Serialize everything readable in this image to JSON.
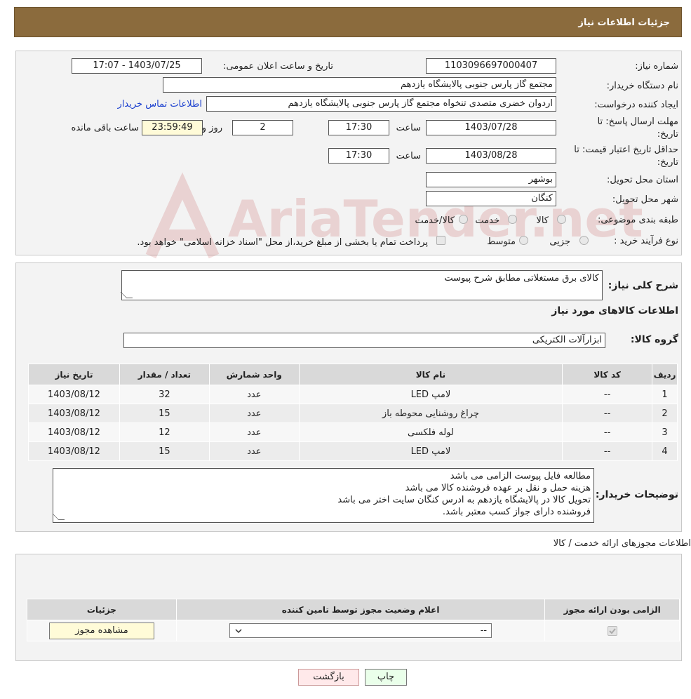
{
  "header": {
    "title": "جزئیات اطلاعات نیاز"
  },
  "info": {
    "need_number_label": "شماره نیاز:",
    "need_number": "1103096697000407",
    "announce_label": "تاریخ و ساعت اعلان عمومی:",
    "announce_value": "1403/07/25 - 17:07",
    "buyer_org_label": "نام دستگاه خریدار:",
    "buyer_org": "مجتمع گاز پارس جنوبی  پالایشگاه یازدهم",
    "requester_label": "ایجاد کننده درخواست:",
    "requester": "اردوان خضری متصدی تنخواه مجتمع گاز پارس جنوبی  پالایشگاه یازدهم",
    "contact_link": "اطلاعات تماس خریدار",
    "deadline_label_1": "مهلت ارسال پاسخ: تا",
    "deadline_label_2": "تاریخ:",
    "deadline_date": "1403/07/28",
    "time_label": "ساعت",
    "deadline_time": "17:30",
    "days": "2",
    "days_label": "روز و",
    "remaining": "23:59:49",
    "remaining_label": "ساعت باقی مانده",
    "validity_label_1": "حداقل تاریخ اعتبار قیمت: تا",
    "validity_label_2": "تاریخ:",
    "validity_date": "1403/08/28",
    "validity_time_label": "ساعت",
    "validity_time": "17:30",
    "province_label": "استان محل تحویل:",
    "province": "بوشهر",
    "city_label": "شهر محل تحویل:",
    "city": "کنگان",
    "category_label": "طبقه بندی موضوعی:",
    "cat_goods": "کالا",
    "cat_service": "خدمت",
    "cat_both": "کالا/خدمت",
    "process_label": "نوع فرآیند خرید :",
    "proc_partial": "جزیی",
    "proc_medium": "متوسط",
    "proc_note": "پرداخت تمام یا بخشی از مبلغ خرید،از محل \"اسناد خزانه اسلامی\" خواهد بود."
  },
  "desc": {
    "label": "شرح کلی نیاز:",
    "value": "کالای برق مستغلاتی مطابق شرح پیوست"
  },
  "goods_title": "اطلاعات کالاهای مورد نیاز",
  "group": {
    "label": "گروه کالا:",
    "value": "ابزارآلات الکتریکی"
  },
  "table": {
    "headers": [
      "ردیف",
      "کد کالا",
      "نام کالا",
      "واحد شمارش",
      "تعداد / مقدار",
      "تاریخ نیاز"
    ],
    "rows": [
      [
        "1",
        "--",
        "لامپ LED",
        "عدد",
        "32",
        "1403/08/12"
      ],
      [
        "2",
        "--",
        "چراغ روشنایی محوطه باز",
        "عدد",
        "15",
        "1403/08/12"
      ],
      [
        "3",
        "--",
        "لوله فلکسی",
        "عدد",
        "12",
        "1403/08/12"
      ],
      [
        "4",
        "--",
        "لامپ LED",
        "عدد",
        "15",
        "1403/08/12"
      ]
    ]
  },
  "buyer_notes": {
    "label": "توضیحات خریدار:",
    "lines": [
      "مطالعه فایل پیوست الزامی می باشد",
      "هزینه حمل و نقل بر عهده فروشنده کالا می باشد",
      "تحویل کالا در پالایشگاه یازدهم به ادرس کنگان سایت اختر می باشد",
      "فروشنده دارای جواز کسب معتبر باشد."
    ]
  },
  "permits": {
    "title": "اطلاعات مجوزهای ارائه خدمت / کالا",
    "headers": [
      "الزامی بودن ارائه مجوز",
      "اعلام وضعیت مجوز توسط تامین کننده",
      "جزئیات"
    ],
    "select_value": "--",
    "view_button": "مشاهده مجوز"
  },
  "buttons": {
    "print": "چاپ",
    "back": "بازگشت"
  },
  "watermark": "AriaTender.net"
}
